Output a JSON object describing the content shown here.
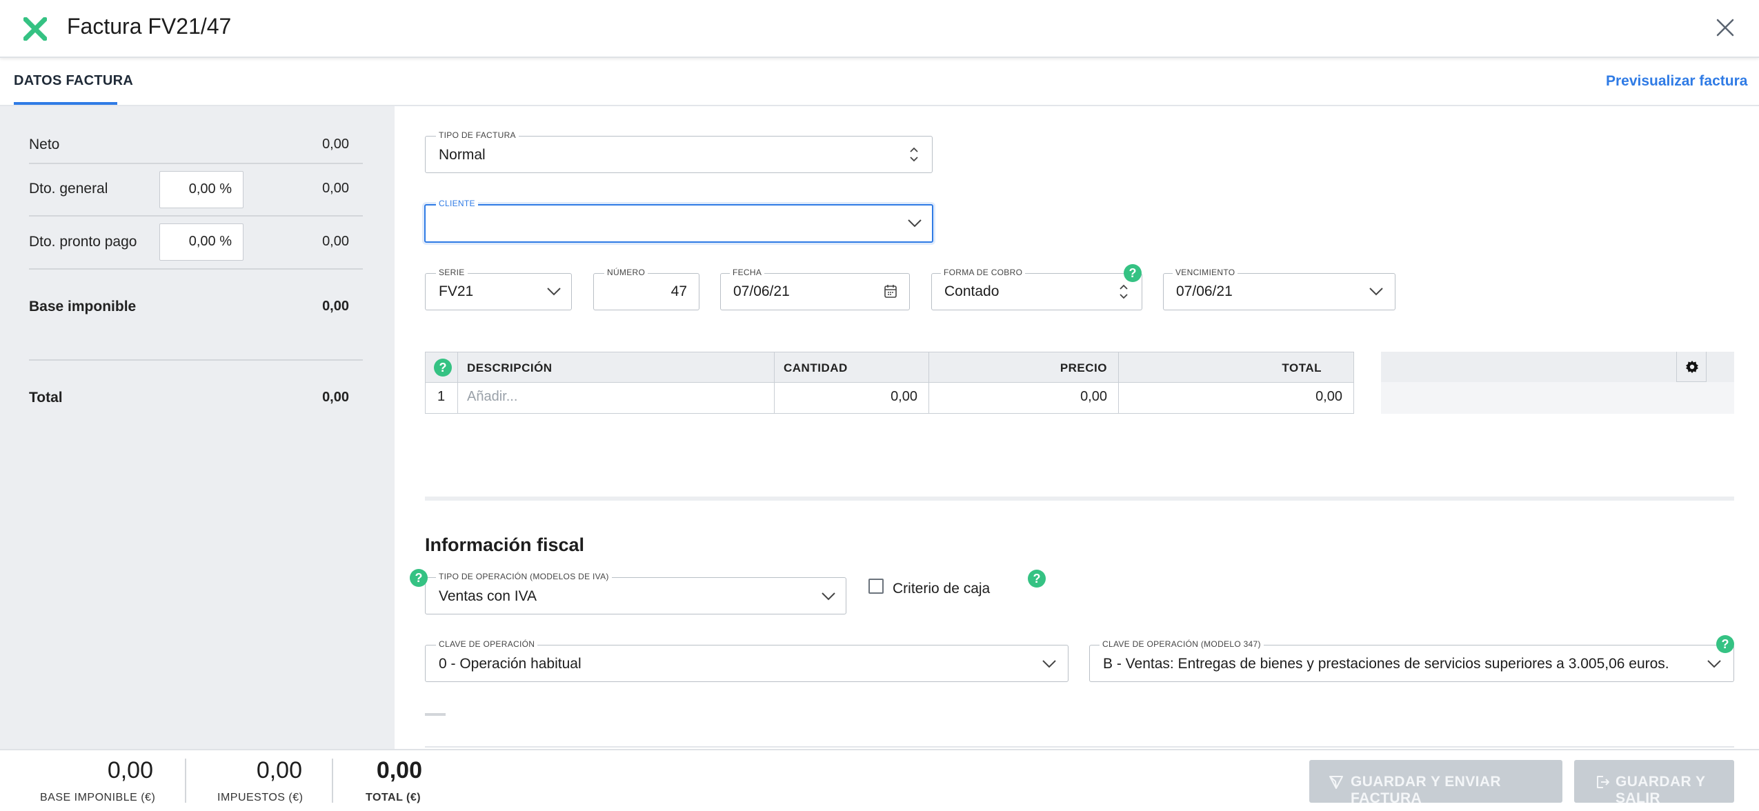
{
  "header": {
    "title": "Factura FV21/47",
    "logo_icon": "holded-logo-icon",
    "close_icon": "close-icon"
  },
  "tabs": {
    "active": "DATOS FACTURA",
    "preview_link": "Previsualizar factura"
  },
  "summary": {
    "neto_label": "Neto",
    "neto_value": "0,00",
    "dto_general_label": "Dto. general",
    "dto_general_pct": "0,00 %",
    "dto_general_value": "0,00",
    "dto_pronto_label": "Dto. pronto pago",
    "dto_pronto_pct": "0,00 %",
    "dto_pronto_value": "0,00",
    "base_label": "Base imponible",
    "base_value": "0,00",
    "total_label": "Total",
    "total_value": "0,00"
  },
  "form": {
    "tipo_label": "TIPO DE FACTURA",
    "tipo_value": "Normal",
    "cliente_label": "CLIENTE",
    "cliente_value": "",
    "serie_label": "SERIE",
    "serie_value": "FV21",
    "numero_label": "NÚMERO",
    "numero_value": "47",
    "fecha_label": "FECHA",
    "fecha_value": "07/06/21",
    "forma_label": "FORMA DE COBRO",
    "forma_value": "Contado",
    "venc_label": "VENCIMIENTO",
    "venc_value": "07/06/21"
  },
  "table": {
    "headers": [
      "DESCRIPCIÓN",
      "CANTIDAD",
      "PRECIO",
      "TOTAL"
    ],
    "rows": [
      {
        "num": "1",
        "descripcion_placeholder": "Añadir...",
        "cantidad": "0,00",
        "precio": "0,00",
        "total": "0,00"
      }
    ]
  },
  "fiscal": {
    "title": "Información fiscal",
    "tipo_op_label": "TIPO DE OPERACIÓN (MODELOS DE IVA)",
    "tipo_op_value": "Ventas con IVA",
    "criterio_caja_label": "Criterio de caja",
    "criterio_caja_checked": false,
    "clave_label": "CLAVE DE OPERACIÓN",
    "clave_value": "0 - Operación habitual",
    "clave347_label": "CLAVE DE OPERACIÓN (MODELO 347)",
    "clave347_value": "B - Ventas: Entregas de bienes y prestaciones de servicios superiores a 3.005,06 euros."
  },
  "footer": {
    "base_value": "0,00",
    "base_label": "BASE IMPONIBLE (€)",
    "impuestos_value": "0,00",
    "impuestos_label": "IMPUESTOS (€)",
    "total_value": "0,00",
    "total_label": "TOTAL (€)",
    "send_button": "GUARDAR Y ENVIAR FACTURA",
    "save_button": "GUARDAR Y SALIR"
  },
  "colors": {
    "accent": "#2f7be5",
    "brand": "#35c283",
    "disabled_button": "#c7cdd3"
  }
}
